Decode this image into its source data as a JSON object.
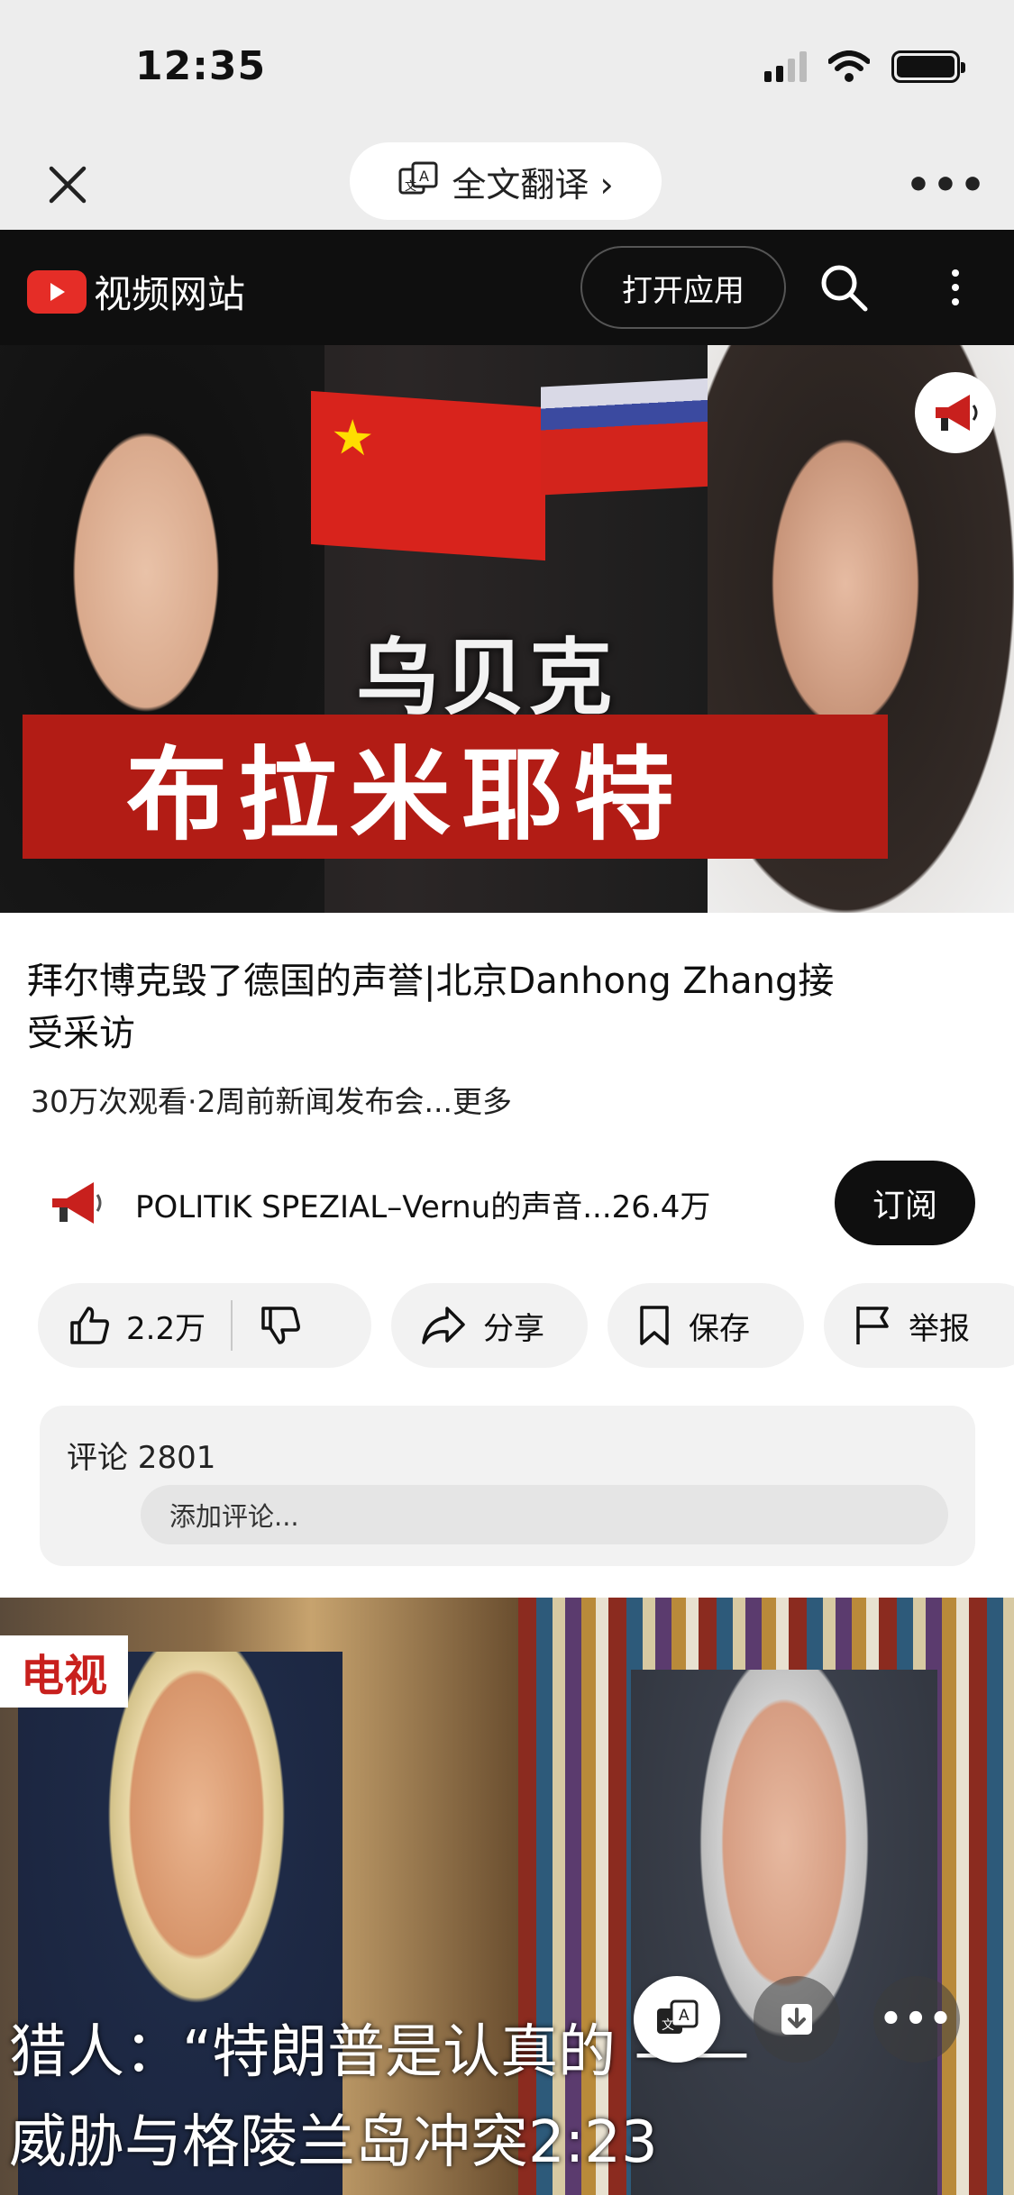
{
  "status_bar": {
    "time": "12:35"
  },
  "browser": {
    "translate_label": "全文翻译 ›",
    "more": "•••"
  },
  "youtube": {
    "logo_text": "视频网站",
    "open_app": "打开应用"
  },
  "thumbnail": {
    "overlay_top": "乌贝克",
    "overlay_banner": "布拉米耶特"
  },
  "video": {
    "title": "拜尔博克毁了德国的声誉|北京Danhong Zhang接受采访",
    "meta": "30万次观看·2周前新闻发布会...更多",
    "channel": "POLITIK SPEZIAL–Vernu的声音...26.4万",
    "subscribe": "订阅"
  },
  "actions": {
    "like_count": "2.2万",
    "share": "分享",
    "save": "保存",
    "report": "举报"
  },
  "comments": {
    "label": "评论 2801",
    "placeholder": "添加评论..."
  },
  "next_video": {
    "badge": "电视",
    "caption_line1": "猎人：“特朗普是认真的 ——",
    "caption_line2": "威胁与格陵兰岛冲突2:23"
  }
}
